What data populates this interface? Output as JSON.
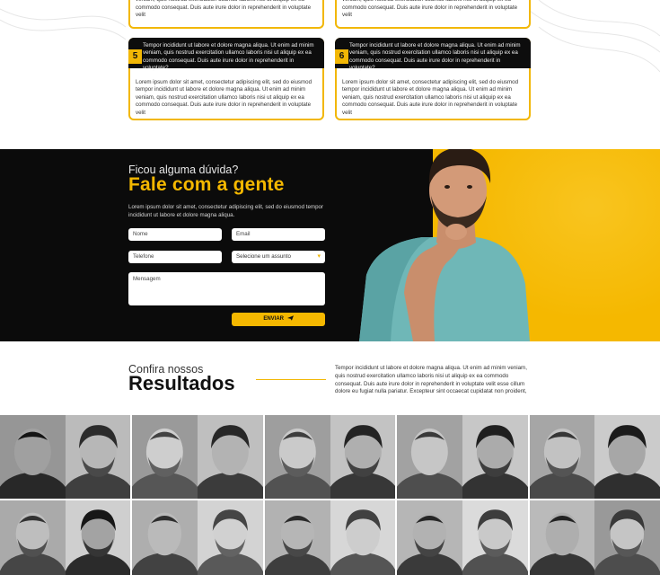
{
  "cards": {
    "stub_left": "veniam, quis nostrud exercitation ullamco laboris nisi ut aliquip ex ea commodo consequat. Duis aute irure dolor in reprehenderit in voluptate velit",
    "stub_right": "veniam, quis nostrud exercitation ullamco laboris nisi ut aliquip ex ea commodo consequat. Duis aute irure dolor in reprehenderit in voluptate velit",
    "items": [
      {
        "number": "5",
        "head": "Tempor incididunt ut labore et dolore magna aliqua. Ut enim ad minim veniam, quis nostrud exercitation ullamco laboris nisi ut aliquip ex ea commodo consequat. Duis aute irure dolor in reprehenderit in voluptate?",
        "body": "Lorem ipsum dolor sit amet, consectetur adipiscing elit, sed do eiusmod tempor incididunt ut labore et dolore magna aliqua. Ut enim ad minim veniam, quis nostrud exercitation ullamco laboris nisi ut aliquip ex ea commodo consequat. Duis aute irure dolor in reprehenderit in voluptate velit"
      },
      {
        "number": "6",
        "head": "Tempor incididunt ut labore et dolore magna aliqua. Ut enim ad minim veniam, quis nostrud exercitation ullamco laboris nisi ut aliquip ex ea commodo consequat. Duis aute irure dolor in reprehenderit in voluptate?",
        "body": "Lorem ipsum dolor sit amet, consectetur adipiscing elit, sed do eiusmod tempor incididunt ut labore et dolore magna aliqua. Ut enim ad minim veniam, quis nostrud exercitation ullamco laboris nisi ut aliquip ex ea commodo consequat. Duis aute irure dolor in reprehenderit in voluptate velit"
      }
    ]
  },
  "contact": {
    "pretitle": "Ficou alguma dúvida?",
    "title": "Fale com a gente",
    "description": "Lorem ipsum dolor sit amet, consectetur adipiscing elit, sed do eiusmod tempor incididunt ut labore et dolore magna aliqua.",
    "form": {
      "name_placeholder": "Nome",
      "email_placeholder": "Email",
      "phone_placeholder": "Telefone",
      "subject_value": "Selecione um assunto",
      "message_placeholder": "Mensagem",
      "send_label": "ENVIAR"
    },
    "colors": {
      "accent": "#f5b800",
      "dark": "#0b0b0b"
    }
  },
  "results": {
    "pretitle": "Confira nossos",
    "title": "Resultados",
    "text": "Tempor incididunt ut labore et dolore magna aliqua. Ut enim ad minim veniam, quis nostrud exercitation ullamco laboris nisi ut aliquip ex ea commodo consequat. Duis aute irure dolor in reprehenderit in voluptate velit esse cillum dolore eu fugiat nulla pariatur. Excepteur sint occaecat cupidatat non proident,"
  }
}
